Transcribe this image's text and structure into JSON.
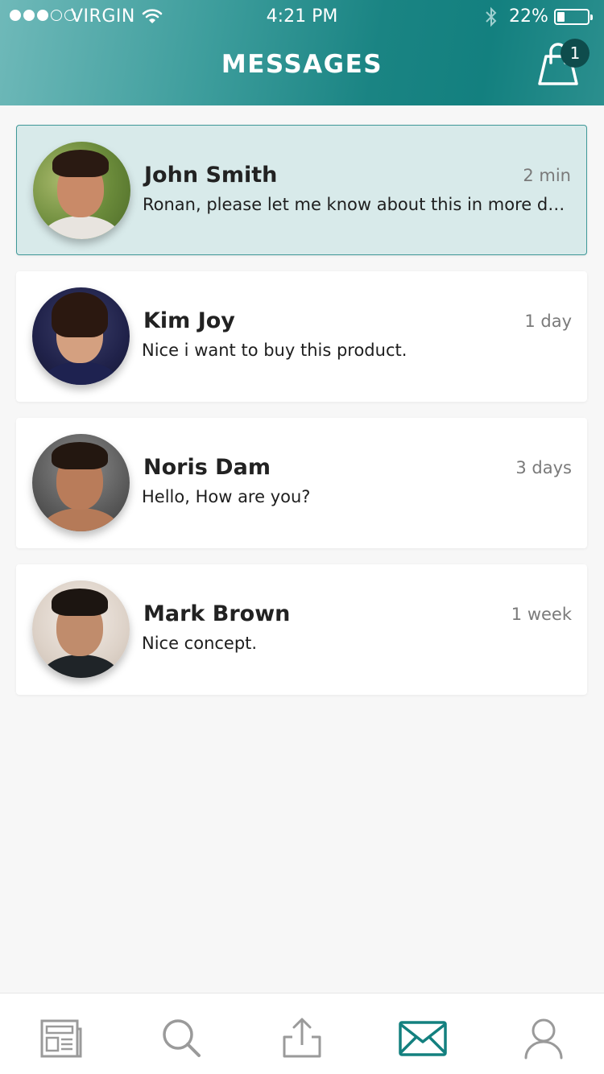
{
  "status_bar": {
    "carrier": "VIRGIN",
    "time": "4:21 PM",
    "battery": "22%",
    "signal_bars": 3,
    "signal_total": 5
  },
  "header": {
    "title": "MESSAGES",
    "cart_icon": "shopping-bag-icon",
    "cart_count": "1"
  },
  "colors": {
    "accent": "#13807f",
    "active_card_bg": "#d8eaea",
    "active_card_border": "#3f9898",
    "badge": "#0e4c4c"
  },
  "messages": [
    {
      "name": "John Smith",
      "time": "2 min",
      "preview": "Ronan, please let me know about this in more details",
      "active": true
    },
    {
      "name": "Kim Joy",
      "time": "1 day",
      "preview": "Nice i want to buy this product.",
      "active": false
    },
    {
      "name": "Noris Dam",
      "time": "3 days",
      "preview": "Hello, How are you?",
      "active": false
    },
    {
      "name": "Mark Brown",
      "time": "1 week",
      "preview": "Nice concept.",
      "active": false
    }
  ],
  "tabs": [
    {
      "icon": "newspaper-icon",
      "active": false
    },
    {
      "icon": "search-icon",
      "active": false
    },
    {
      "icon": "upload-icon",
      "active": false
    },
    {
      "icon": "mail-icon",
      "active": true
    },
    {
      "icon": "profile-icon",
      "active": false
    }
  ]
}
